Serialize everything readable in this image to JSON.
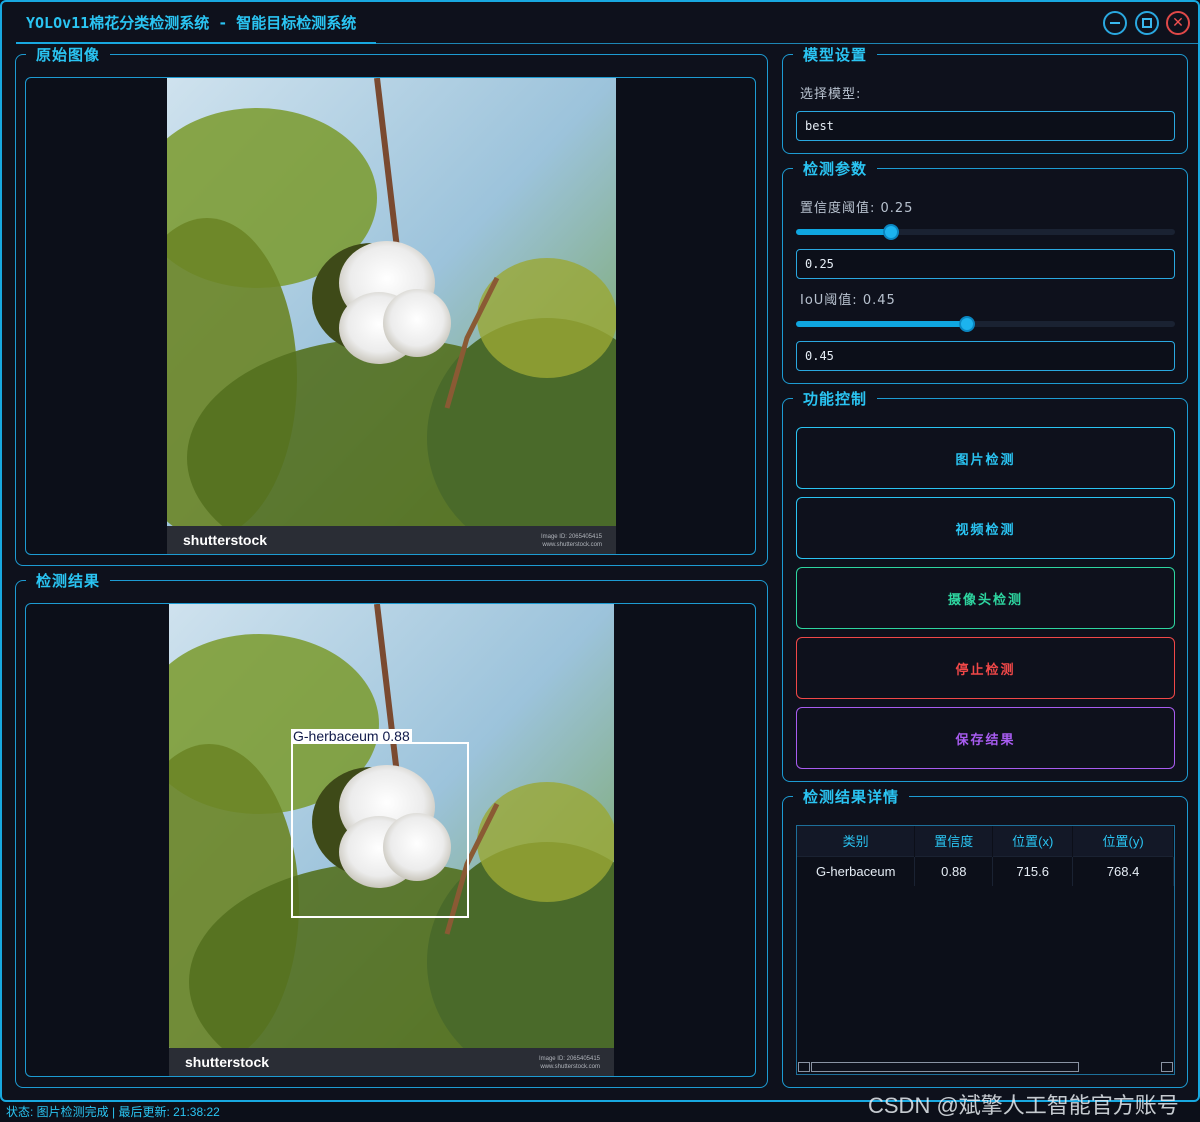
{
  "window": {
    "title": "YOLOv11棉花分类检测系统 - 智能目标检测系统",
    "accent": "#18a8e0"
  },
  "panels": {
    "original": {
      "title": "原始图像"
    },
    "result": {
      "title": "检测结果"
    }
  },
  "stock_watermark": {
    "logo": "shutterstock",
    "id_line": "Image ID: 2065405415",
    "site": "www.shutterstock.com"
  },
  "detection": {
    "label": "G-herbaceum  0.88"
  },
  "model_settings": {
    "title": "模型设置",
    "select_label": "选择模型:",
    "selected_model": "best"
  },
  "detect_params": {
    "title": "检测参数",
    "conf_label": "置信度阈值: 0.25",
    "conf_value": "0.25",
    "conf_level": 0.25,
    "iou_label": "IoU阈值: 0.45",
    "iou_value": "0.45",
    "iou_level": 0.45
  },
  "controls": {
    "title": "功能控制",
    "buttons": [
      {
        "label": "图片检测",
        "color": "#2ac4f2"
      },
      {
        "label": "视频检测",
        "color": "#2ac4f2"
      },
      {
        "label": "摄像头检测",
        "color": "#2ed6a0"
      },
      {
        "label": "停止检测",
        "color": "#f04848"
      },
      {
        "label": "保存结果",
        "color": "#a85cf0"
      }
    ]
  },
  "results": {
    "title": "检测结果详情",
    "columns": [
      "类别",
      "置信度",
      "位置(x)",
      "位置(y)"
    ],
    "rows": [
      [
        "G-herbaceum",
        "0.88",
        "715.6",
        "768.4"
      ]
    ]
  },
  "status": {
    "text": "状态: 图片检测完成 | 最后更新: 21:38:22"
  },
  "watermark": "CSDN @斌擎人工智能官方账号"
}
